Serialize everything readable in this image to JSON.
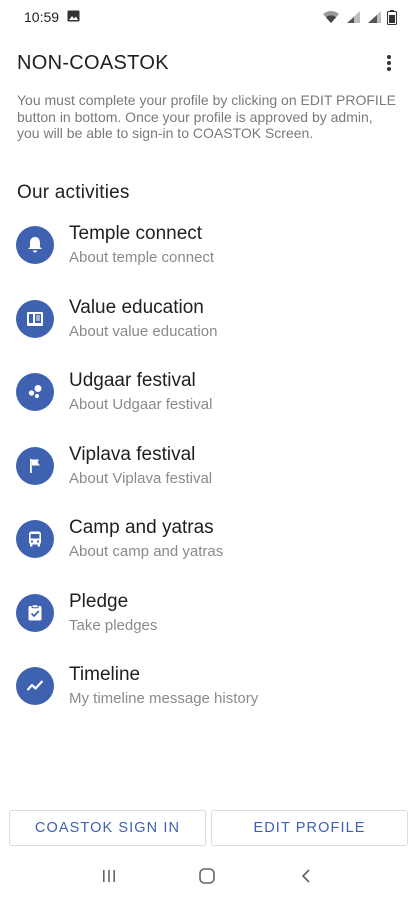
{
  "status_bar": {
    "time": "10:59",
    "icons": [
      "image-icon",
      "wifi-icon",
      "signal-icon",
      "signal-icon",
      "battery-icon"
    ]
  },
  "app_bar": {
    "title": "NON-COASTOK",
    "menu_icon": "more-vert-icon"
  },
  "notice": "You must complete your profile by clicking on EDIT PROFILE button in bottom. Once your profile is approved by admin, you will be able to sign-in to COASTOK Screen.",
  "section_title": "Our activities",
  "activities": [
    {
      "title": "Temple connect",
      "subtitle": "About temple connect",
      "icon": "bell-icon"
    },
    {
      "title": "Value education",
      "subtitle": "About value education",
      "icon": "book-icon"
    },
    {
      "title": "Udgaar festival",
      "subtitle": "About Udgaar festival",
      "icon": "bubbles-icon"
    },
    {
      "title": "Viplava festival",
      "subtitle": "About Viplava festival",
      "icon": "flag-icon"
    },
    {
      "title": "Camp and yatras",
      "subtitle": "About camp and yatras",
      "icon": "bus-icon"
    },
    {
      "title": "Pledge",
      "subtitle": "Take pledges",
      "icon": "clipboard-check-icon"
    },
    {
      "title": "Timeline",
      "subtitle": "My timeline message history",
      "icon": "trending-icon"
    }
  ],
  "buttons": {
    "sign_in": "COASTOK SIGN IN",
    "edit_profile": "EDIT PROFILE"
  },
  "colors": {
    "accent": "#3e61b0",
    "subtitle": "#8a8a8a",
    "notice": "#7a7a7a"
  },
  "nav_bar": {
    "icons": [
      "recents-icon",
      "home-icon",
      "back-icon"
    ]
  }
}
